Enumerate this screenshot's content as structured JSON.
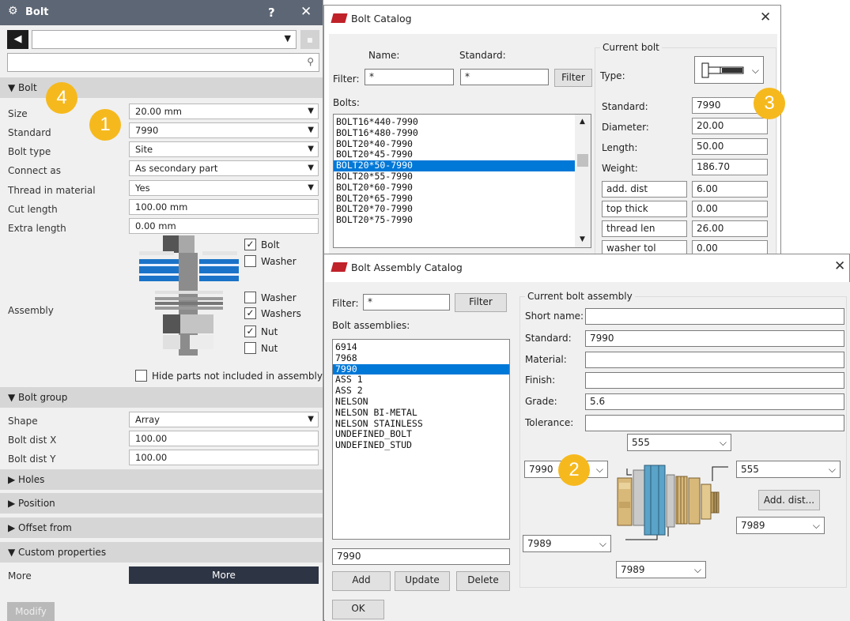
{
  "props": {
    "title": "Bolt",
    "help": "?",
    "close": "✕",
    "sections": {
      "bolt": "▼ Bolt",
      "bolt_group": "▼ Bolt group",
      "holes": "▶ Holes",
      "position": "▶ Position",
      "offset_from": "▶ Offset from",
      "custom": "▼ Custom properties"
    },
    "fields": [
      {
        "label": "Size",
        "value": "20.00 mm",
        "dropdown": true
      },
      {
        "label": "Standard",
        "value": "7990",
        "dropdown": true
      },
      {
        "label": "Bolt type",
        "value": "Site",
        "dropdown": true
      },
      {
        "label": "Connect as",
        "value": "As secondary part",
        "dropdown": true
      },
      {
        "label": "Thread in material",
        "value": "Yes",
        "dropdown": true
      },
      {
        "label": "Cut length",
        "value": "100.00 mm",
        "dropdown": false
      },
      {
        "label": "Extra length",
        "value": "0.00 mm",
        "dropdown": false
      }
    ],
    "assembly_label": "Assembly",
    "checks": [
      {
        "label": "Bolt",
        "checked": true
      },
      {
        "label": "Washer",
        "checked": false
      },
      {
        "label": "Washer",
        "checked": false
      },
      {
        "label": "Washers",
        "checked": true
      },
      {
        "label": "Nut",
        "checked": true
      },
      {
        "label": "Nut",
        "checked": false
      }
    ],
    "hide_parts": "Hide parts not included in assembly",
    "group_fields": [
      {
        "label": "Shape",
        "value": "Array",
        "dropdown": true
      },
      {
        "label": "Bolt dist X",
        "value": "100.00",
        "dropdown": false
      },
      {
        "label": "Bolt dist Y",
        "value": "100.00",
        "dropdown": false
      }
    ],
    "more_label": "More",
    "more_button": "More",
    "modify_button": "Modify"
  },
  "badges": [
    "1",
    "2",
    "3",
    "4"
  ],
  "catalog": {
    "title": "Bolt Catalog",
    "close": "✕",
    "name_label": "Name:",
    "standard_label": "Standard:",
    "filter_label": "Filter:",
    "name_filter": "*",
    "standard_filter": "*",
    "filter_button": "Filter",
    "bolts_label": "Bolts:",
    "bolts": [
      "BOLT16*440-7990",
      "BOLT16*480-7990",
      "BOLT20*40-7990",
      "BOLT20*45-7990",
      "BOLT20*50-7990",
      "BOLT20*55-7990",
      "BOLT20*60-7990",
      "BOLT20*65-7990",
      "BOLT20*70-7990",
      "BOLT20*75-7990"
    ],
    "selected_bolt_index": 4,
    "current_title": "Current bolt",
    "type_label": "Type:",
    "props": [
      {
        "label": "Standard:",
        "value": "7990"
      },
      {
        "label": "Diameter:",
        "value": "20.00"
      },
      {
        "label": "Length:",
        "value": "50.00"
      },
      {
        "label": "Weight:",
        "value": "186.70"
      }
    ],
    "extra_props": [
      {
        "label": "add. dist",
        "value": "6.00"
      },
      {
        "label": "top thick",
        "value": "0.00"
      },
      {
        "label": "thread len",
        "value": "26.00"
      },
      {
        "label": "washer tol",
        "value": "0.00"
      }
    ]
  },
  "assembly": {
    "title": "Bolt Assembly Catalog",
    "close": "✕",
    "filter_label": "Filter:",
    "filter_value": "*",
    "filter_button": "Filter",
    "list_label": "Bolt assemblies:",
    "items": [
      "6914",
      "7968",
      "7990",
      "ASS 1",
      "ASS 2",
      "NELSON",
      "NELSON BI-METAL",
      "NELSON STAINLESS",
      "UNDEFINED_BOLT",
      "UNDEFINED_STUD"
    ],
    "selected_index": 2,
    "name_value": "7990",
    "add_button": "Add",
    "update_button": "Update",
    "delete_button": "Delete",
    "ok_button": "OK",
    "current_title": "Current bolt assembly",
    "fields": [
      {
        "label": "Short name:",
        "value": ""
      },
      {
        "label": "Standard:",
        "value": "7990"
      },
      {
        "label": "Material:",
        "value": ""
      },
      {
        "label": "Finish:",
        "value": ""
      },
      {
        "label": "Grade:",
        "value": "5.6"
      },
      {
        "label": "Tolerance:",
        "value": ""
      }
    ],
    "top_washer": "555",
    "head_select": "7990",
    "right_washer": "555",
    "add_dist_button": "Add. dist...",
    "right_nut": "7989",
    "left_nut": "7989",
    "bottom_nut": "7989"
  }
}
